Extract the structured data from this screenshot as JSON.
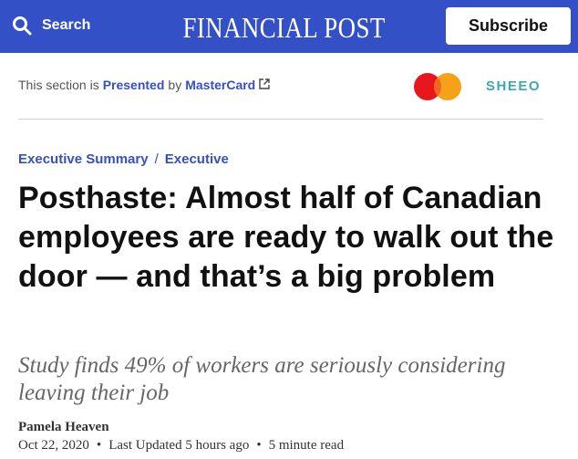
{
  "header": {
    "search_label": "Search",
    "masthead": "FINANCIAL POST",
    "subscribe_label": "Subscribe",
    "background_color": "#3450c6"
  },
  "sponsor": {
    "prefix": "This section is",
    "presented_label": "Presented",
    "by_label": "by",
    "sponsor_name": "MasterCard",
    "partner_logo": "SHEEO",
    "partner_color": "#3aa9b5",
    "icons": [
      "external-link-icon",
      "mastercard-logo"
    ]
  },
  "breadcrumb": {
    "section": "Executive Summary",
    "separator": "/",
    "subsection": "Executive"
  },
  "article": {
    "headline": "Posthaste: Almost half of Canadian employees are ready to walk out the door — and that’s a big problem",
    "subheadline": "Study finds 49% of workers are seriously considering leaving their job",
    "author": "Pamela Heaven",
    "date": "Oct 22, 2020",
    "last_updated": "Last Updated 5 hours ago",
    "read_time": "5 minute read",
    "bullet": "•"
  },
  "colors": {
    "accent": "#3450c6",
    "headline": "#111111",
    "subhead": "#666666"
  }
}
